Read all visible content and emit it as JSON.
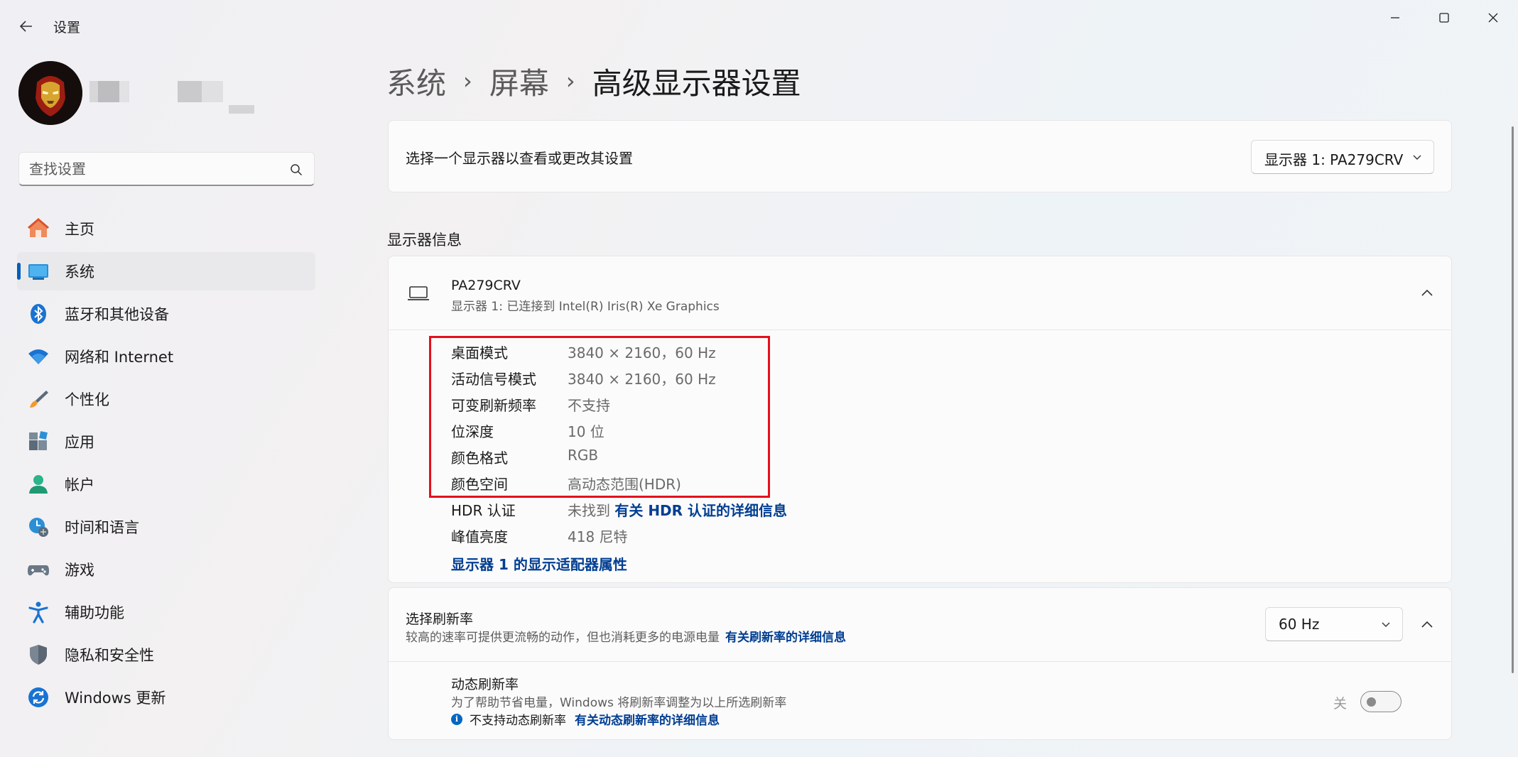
{
  "window": {
    "app_title": "设置",
    "controls": [
      "minimize",
      "maximize",
      "close"
    ]
  },
  "sidebar": {
    "search_placeholder": "查找设置",
    "items": [
      {
        "label": "主页",
        "icon": "home-icon"
      },
      {
        "label": "系统",
        "icon": "system-icon",
        "active": true
      },
      {
        "label": "蓝牙和其他设备",
        "icon": "bluetooth-icon"
      },
      {
        "label": "网络和 Internet",
        "icon": "wifi-icon"
      },
      {
        "label": "个性化",
        "icon": "brush-icon"
      },
      {
        "label": "应用",
        "icon": "apps-icon"
      },
      {
        "label": "帐户",
        "icon": "account-icon"
      },
      {
        "label": "时间和语言",
        "icon": "time-language-icon"
      },
      {
        "label": "游戏",
        "icon": "gamepad-icon"
      },
      {
        "label": "辅助功能",
        "icon": "accessibility-icon"
      },
      {
        "label": "隐私和安全性",
        "icon": "shield-icon"
      },
      {
        "label": "Windows 更新",
        "icon": "update-icon"
      }
    ]
  },
  "breadcrumb": {
    "level1": "系统",
    "level2": "屏幕",
    "current": "高级显示器设置"
  },
  "select_display": {
    "label": "选择一个显示器以查看或更改其设置",
    "selected": "显示器 1: PA279CRV"
  },
  "display_info": {
    "section_title": "显示器信息",
    "name": "PA279CRV",
    "subtitle": "显示器 1: 已连接到 Intel(R) Iris(R) Xe Graphics",
    "rows": [
      {
        "key": "桌面模式",
        "value": "3840 × 2160，60 Hz"
      },
      {
        "key": "活动信号模式",
        "value": "3840 × 2160，60 Hz"
      },
      {
        "key": "可变刷新频率",
        "value": "不支持"
      },
      {
        "key": "位深度",
        "value": "10 位"
      },
      {
        "key": "颜色格式",
        "value": "RGB"
      },
      {
        "key": "颜色空间",
        "value": "高动态范围(HDR)"
      },
      {
        "key": "HDR 认证",
        "value": "未找到",
        "link": "有关 HDR 认证的详细信息"
      },
      {
        "key": "峰值亮度",
        "value": "418 尼特"
      }
    ],
    "adapter_link": "显示器 1 的显示适配器属性"
  },
  "refresh_rate": {
    "title": "选择刷新率",
    "description": "较高的速率可提供更流畅的动作，但也消耗更多的电源电量",
    "description_link": "有关刷新率的详细信息",
    "selected": "60 Hz",
    "dynamic": {
      "title": "动态刷新率",
      "description": "为了帮助节省电量，Windows 将刷新率调整为以上所选刷新率",
      "note": "不支持动态刷新率",
      "note_link": "有关动态刷新率的详细信息",
      "toggle_label": "关",
      "toggle_on": false
    }
  },
  "colors": {
    "accent": "#005fb8",
    "link": "#003e92",
    "highlight_box": "#e4101b"
  }
}
